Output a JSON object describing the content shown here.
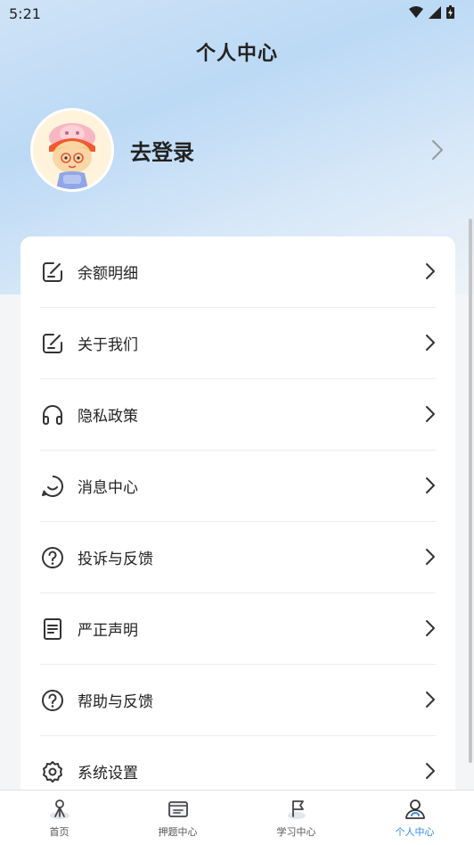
{
  "status_bar": {
    "time": "5:21"
  },
  "header": {
    "title": "个人中心"
  },
  "profile": {
    "login_label": "去登录"
  },
  "menu": {
    "items": [
      {
        "label": "余额明细",
        "icon": "edit-note-icon"
      },
      {
        "label": "关于我们",
        "icon": "edit-note-icon"
      },
      {
        "label": "隐私政策",
        "icon": "headphones-icon"
      },
      {
        "label": "消息中心",
        "icon": "message-smile-icon"
      },
      {
        "label": "投诉与反馈",
        "icon": "question-circle-icon"
      },
      {
        "label": "严正声明",
        "icon": "document-icon"
      },
      {
        "label": "帮助与反馈",
        "icon": "question-circle-icon"
      },
      {
        "label": "系统设置",
        "icon": "settings-gear-icon"
      }
    ]
  },
  "tabbar": {
    "tabs": [
      {
        "label": "首页",
        "icon": "home-icon",
        "active": false
      },
      {
        "label": "押题中心",
        "icon": "folder-icon",
        "active": false
      },
      {
        "label": "学习中心",
        "icon": "flag-icon",
        "active": false
      },
      {
        "label": "个人中心",
        "icon": "person-icon",
        "active": true
      }
    ]
  },
  "colors": {
    "accent": "#2f8cf4",
    "text": "#222222",
    "icon": "#333333"
  }
}
